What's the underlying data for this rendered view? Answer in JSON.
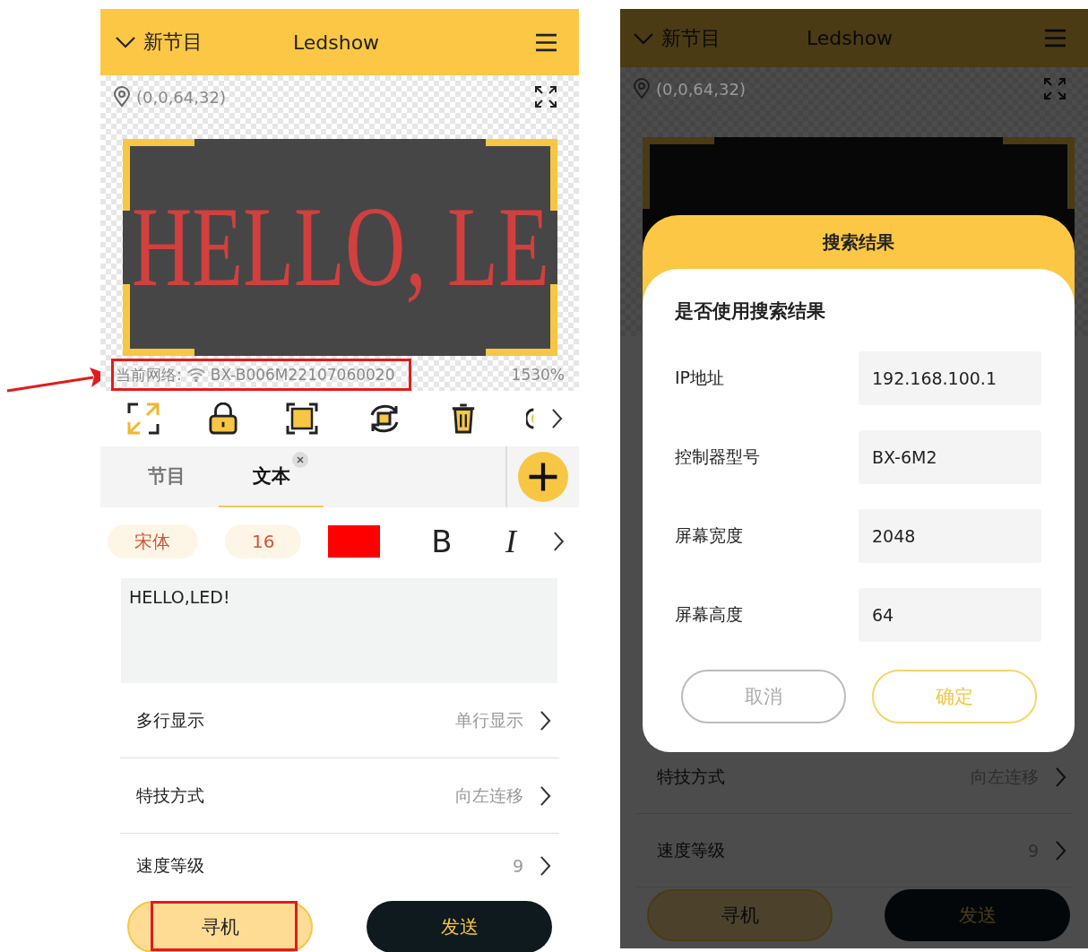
{
  "left_screen": {
    "header": {
      "program": "新节目",
      "title": "Ledshow"
    },
    "position": "(0,0,64,32)",
    "display_text": "HELLO, LE",
    "network": {
      "label": "当前网络:",
      "name": "BX-B006M22107060020",
      "highlighted": true,
      "arrow": true
    },
    "zoom": "1530%",
    "tabs": [
      {
        "label": "节目",
        "selected": false,
        "closable": false
      },
      {
        "label": "文本",
        "selected": true,
        "closable": true
      }
    ],
    "format": {
      "font": "宋体",
      "size": "16",
      "color": "#ff0000",
      "bold": "B",
      "italic": "I"
    },
    "text_value": "HELLO,LED!",
    "settings": [
      {
        "label": "多行显示",
        "value": "单行显示"
      },
      {
        "label": "特技方式",
        "value": "向左连移"
      },
      {
        "label": "速度等级",
        "value": "9"
      }
    ],
    "buttons": [
      {
        "label": "寻机",
        "kind": "find",
        "highlighted": true
      },
      {
        "label": "发送",
        "kind": "send",
        "highlighted": false
      }
    ]
  },
  "right_screen": {
    "header": {
      "program": "新节目",
      "title": "Ledshow"
    },
    "position": "(0,0,64,32)",
    "dimmed": true,
    "settings": [
      {
        "label": "特技方式",
        "value": "向左连移"
      },
      {
        "label": "速度等级",
        "value": "9"
      }
    ],
    "buttons": [
      {
        "label": "寻机",
        "kind": "find",
        "highlighted": false
      },
      {
        "label": "发送",
        "kind": "send",
        "highlighted": false
      }
    ],
    "dialog": {
      "title": "搜索结果",
      "question": "是否使用搜索结果",
      "fields": [
        {
          "label": "IP地址",
          "value": "192.168.100.1"
        },
        {
          "label": "控制器型号",
          "value": "BX-6M2"
        },
        {
          "label": "屏幕宽度",
          "value": "2048"
        },
        {
          "label": "屏幕高度",
          "value": "64"
        }
      ],
      "buttons": [
        {
          "label": "取消",
          "kind": "cancel"
        },
        {
          "label": "确定",
          "kind": "confirm"
        }
      ]
    }
  }
}
